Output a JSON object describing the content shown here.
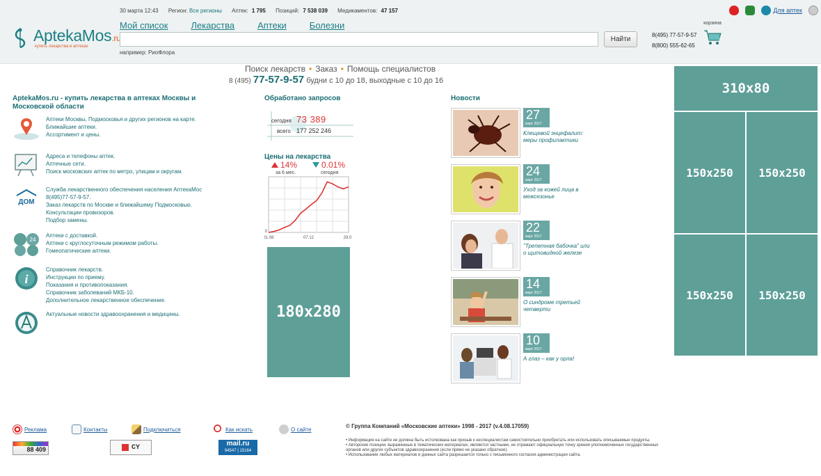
{
  "topbar": {
    "datetime": "30 марта 12:43",
    "region_label": "Регион:",
    "region_value": "Все регионы",
    "pharmacies_label": "Аптек:",
    "pharmacies_value": "1 795",
    "positions_label": "Позиций:",
    "positions_value": "7 538 039",
    "medicines_label": "Медикаментов:",
    "medicines_value": "47 157",
    "partner_link": "Для аптек"
  },
  "logo": {
    "name": "AptekaMos",
    "domain": ".ru",
    "tagline": "купить лекарства в аптеках"
  },
  "nav": [
    "Мой список",
    "Лекарства",
    "Аптеки",
    "Болезни"
  ],
  "search": {
    "value": "",
    "button": "Найти",
    "example": "например: РиоФлора"
  },
  "contacts": {
    "phone1": "8(495) 77-57-9-57",
    "phone2": "8(800) 555-62-65",
    "cart_label": "корзина"
  },
  "services": [
    "Поиск лекарств",
    "Заказ",
    "Помощь специалистов"
  ],
  "hours": {
    "code": "8 (495)",
    "phone": "77-57-9-57",
    "schedule": "будни с 10 до 18, выходные с 10 до 16"
  },
  "about": {
    "title": "AptekaMos.ru - купить лекарства в аптеках Москвы и Московской области",
    "features": [
      {
        "icon": "map-pin-icon",
        "lines": [
          "Аптеки Москвы, Подмосковья и других регионов на карте.",
          "Ближайшие аптеки.",
          "Ассортимент и цены."
        ]
      },
      {
        "icon": "presentation-board-icon",
        "lines": [
          "Адреса и телефоны аптек.",
          "Аптечные сети.",
          "Поиск московских аптек по метро, улицам и округам."
        ]
      },
      {
        "icon": "dom-zdorovya-logo-icon",
        "lines": [
          "Служба лекарственного обеспечения населения АптекаМос",
          "8(495)77-57-9-57.",
          "Заказ лекарств по Москве и ближайшему Подмосковью.",
          "Консультации провизоров.",
          "Подбор замены."
        ]
      },
      {
        "icon": "delivery-24-icon",
        "lines": [
          "Аптеки с доставкой.",
          "Аптеки с круглосуточным режимом работы.",
          "Гомеопатические аптеки."
        ]
      },
      {
        "icon": "info-icon",
        "lines": [
          "Справочник лекарств.",
          "Инструкции по приему.",
          "Показания и противопоказания.",
          "Справочник заболеваний МКБ-10.",
          "Дополнительное лекарственное обеспечение."
        ]
      },
      {
        "icon": "news-logo-icon",
        "lines": [
          "Актуальные новости здравоохранения и медицины."
        ]
      }
    ]
  },
  "requests": {
    "title": "Обработано запросов",
    "today_label": "сегодня",
    "today_value": "73 389",
    "total_label": "всего",
    "total_value": "177 252 246"
  },
  "prices": {
    "title": "Цены на лекарства",
    "up_value": "14%",
    "up_sub": "за 6 мес.",
    "down_value": "0.01%",
    "down_sub": "сегодня",
    "accent_up": "#dd3333",
    "accent_down": "#2a9a9a"
  },
  "chart_data": {
    "type": "line",
    "title": "Цены на лекарства",
    "x_ticks": [
      "31.08",
      "07.12",
      "29.03"
    ],
    "y_ticks": [
      "0"
    ],
    "series": [
      {
        "values": [
          0,
          2,
          5,
          10,
          14,
          24,
          38,
          46,
          55,
          63,
          78,
          100,
          96,
          90,
          86,
          90
        ]
      }
    ],
    "ylim": [
      0,
      110
    ],
    "grid": true
  },
  "ads": {
    "left": "180x280",
    "top": "310x80",
    "a": "150x250",
    "b": "150x250",
    "c": "150x250",
    "d": "150x250",
    "color": "#5e9f98"
  },
  "news": {
    "title": "Новости",
    "items": [
      {
        "day": "27",
        "month": "март 2017",
        "title": "Клещевой энцефалит: меры профилактики",
        "image": "tick-image"
      },
      {
        "day": "24",
        "month": "март 2017",
        "title": "Уход за кожей лица в межсезонье",
        "image": "woman-face-image"
      },
      {
        "day": "22",
        "month": "март 2017",
        "title": "\"Трепетная бабочка\" или о щитовидной железе",
        "image": "doctor-consult-image"
      },
      {
        "day": "14",
        "month": "март 2017",
        "title": "О синдроме третьей четверти",
        "image": "classroom-image"
      },
      {
        "day": "10",
        "month": "март 2017",
        "title": "А глаз – как у орла!",
        "image": "eye-exam-image"
      }
    ]
  },
  "footer": {
    "links": [
      {
        "label": "Реклама",
        "icon": "ad-target-icon"
      },
      {
        "label": "Контакты",
        "icon": "envelope-icon"
      },
      {
        "label": "Подключиться",
        "icon": "pencil-icon"
      },
      {
        "label": "Как искать",
        "icon": "search-icon"
      },
      {
        "label": "О сайте",
        "icon": "about-icon"
      }
    ],
    "copyright": "© Группа Компаний «Московские аптеки» 1998 - 2017 (v.4.08.17059)",
    "disclaimer": [
      "• Информация на сайте не должна быть истолкована как призыв к неспециалистам самостоятельно приобретать или использовать описываемые продукты.",
      "• Авторские позиции, выраженные в тематических материалах, являются частными, не отражают официальную точку зрения уполномоченных государственных органов или других субъектов здравоохранения (если прямо не указано обратное).",
      "• Использование любых материалов и данных сайта разрешается только с письменного согласия администрации сайта."
    ],
    "counter1": "88 409",
    "counter2_label": "CY",
    "counter3_brand": "mail.ru",
    "counter3_a": "94547",
    "counter3_b": "15164"
  }
}
